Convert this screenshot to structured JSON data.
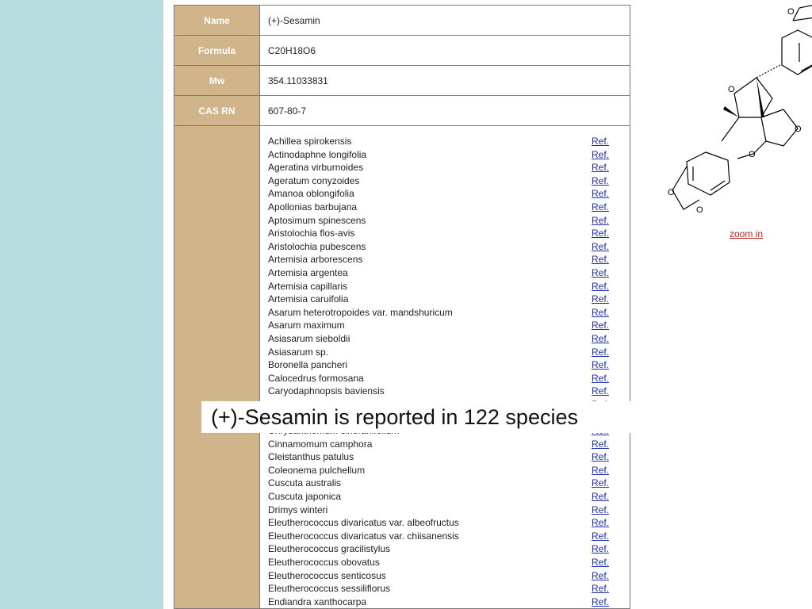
{
  "compound": {
    "name_label": "Name",
    "name_value": "(+)-Sesamin",
    "formula_label": "Formula",
    "formula_value": "C20H18O6",
    "mw_label": "Mw",
    "mw_value": "354.11033831",
    "cas_label": "CAS RN",
    "cas_value": "607-80-7"
  },
  "species": [
    "Achillea spirokensis",
    "Actinodaphne longifolia",
    "Ageratina virburnoides",
    "Ageratum conyzoides",
    "Amanoa oblongifolia",
    "Apollonias barbujana",
    "Aptosimum spinescens",
    "Aristolochia flos-avis",
    "Aristolochia pubescens",
    "Artemisia arborescens",
    "Artemisia argentea",
    "Artemisia capillaris",
    "Artemisia caruifolia",
    "Asarum heterotropoides var. mandshuricum",
    "Asarum maximum",
    "Asiasarum sieboldii",
    "Asiasarum sp.",
    "Boronella pancheri",
    "Calocedrus formosana",
    "Caryodaphnopsis baviensis",
    "",
    "",
    "Chrysanthemum cinerariifolium",
    "Cinnamomum camphora",
    "Cleistanthus patulus",
    "Coleonema pulchellum",
    "Cuscuta australis",
    "Cuscuta japonica",
    "Drimys winteri",
    "Eleutherococcus divaricatus var. albeofructus",
    "Eleutherococcus divaricatus var. chiisanensis",
    "Eleutherococcus gracilistylus",
    "Eleutherococcus obovatus",
    "Eleutherococcus senticosus",
    "Eleutherococcus sessiliflorus",
    "Endiandra xanthocarpa"
  ],
  "ref_label": "Ref.",
  "structure": {
    "zoom_label": "zoom in"
  },
  "caption": "(+)-Sesamin is reported in 122 species",
  "colors": {
    "label_bg": "#d0b48a",
    "background": "#b8dde0",
    "link": "#1f2fa8",
    "zoom_link": "#c0221c"
  }
}
